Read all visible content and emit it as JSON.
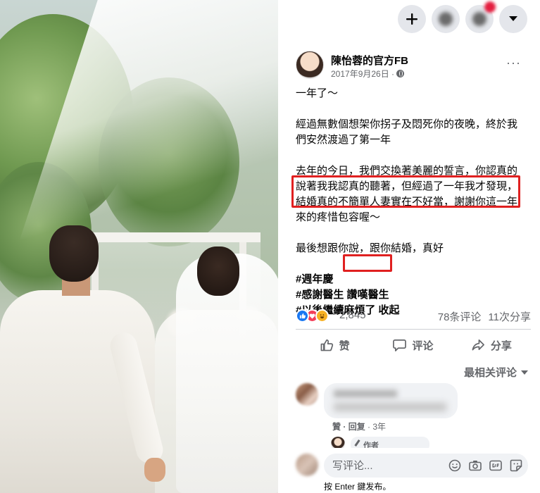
{
  "header": {
    "create_icon": "plus-icon",
    "menu_icon": "caret-down-icon",
    "create_label": "+"
  },
  "post": {
    "page_name": "陳怡蓉的官方FB",
    "date": "2017年9月26日 ·",
    "privacy_icon": "globe-icon",
    "more_label": "···",
    "lines": [
      "一年了～",
      "經過無數個想架你拐子及悶死你的夜晚，終於我",
      "們安然渡過了第一年",
      "去年的今日，我們交換著美麗的誓言，你認真的",
      "說著我我認真的聽著，但經過了一年我才發現，",
      "結婚真的不簡單人妻實在不好當，謝謝你這一年",
      "來的疼惜包容喔～",
      "最後想跟你說，跟你結婚，真好"
    ],
    "hashtags": [
      "#週年慶",
      "#感謝醫生",
      "讚嘆醫生",
      "#以後繼續麻煩了 收起"
    ]
  },
  "reactions": {
    "count": "2,845",
    "comments": "78条评论",
    "shares": "11次分享"
  },
  "actions": {
    "like": "赞",
    "comment": "评论",
    "share": "分享"
  },
  "comments": {
    "sort_label": "最相关评论",
    "first_meta_like": "贊",
    "first_meta_reply": "· 回复",
    "first_meta_time": "· 3年",
    "author_badge": "作者"
  },
  "composer": {
    "placeholder": "写评论...",
    "hint": "按 Enter 鍵发布。"
  },
  "colors": {
    "accent": "#1877f2",
    "highlight_box": "#e02020",
    "secondary_text": "#65676b"
  }
}
